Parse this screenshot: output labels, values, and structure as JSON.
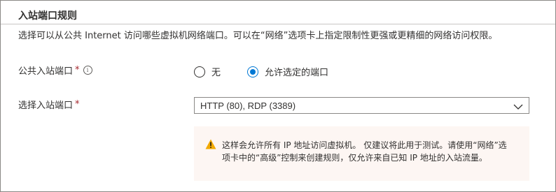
{
  "section": {
    "title": "入站端口规则",
    "description": "选择可以从公共 Internet 访问哪些虚拟机网络端口。可以在“网络”选项卡上指定限制性更强或更精细的网络访问权限。"
  },
  "public_ports": {
    "label": "公共入站端口",
    "required_mark": "*",
    "info_glyph": "i",
    "options": [
      {
        "label": "无",
        "checked": false
      },
      {
        "label": "允许选定的端口",
        "checked": true
      }
    ]
  },
  "select_ports": {
    "label": "选择入站端口",
    "required_mark": "*",
    "value": "HTTP (80), RDP (3389)"
  },
  "warning": {
    "icon": "warning-icon",
    "line1": "这样会允许所有 IP 地址访问虚拟机。 仅建议将此用于测试。请使用“网络”选",
    "line2": "项卡中的“高级”控制来创建规则，仅允许来自已知 IP 地址的入站流量。"
  },
  "colors": {
    "accent": "#0078d4",
    "required": "#a4262c",
    "warning_icon": "#f2a900",
    "warning_bg": "#fdf6f3"
  }
}
